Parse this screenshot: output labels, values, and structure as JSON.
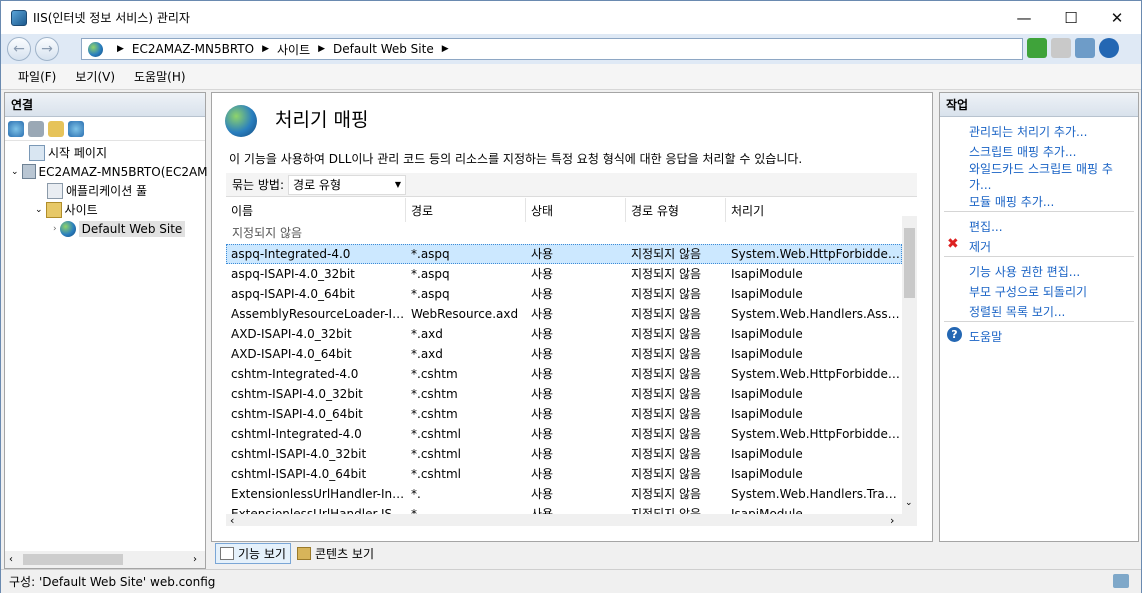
{
  "window": {
    "title": "IIS(인터넷 정보 서비스) 관리자",
    "minimize": "—",
    "maximize": "☐",
    "close": "✕"
  },
  "address": {
    "crumbs": [
      "EC2AMAZ-MN5BRTO",
      "사이트",
      "Default Web Site"
    ]
  },
  "menu": [
    "파일(F)",
    "보기(V)",
    "도움말(H)"
  ],
  "connections": {
    "title": "연결",
    "tree": [
      {
        "label": "시작 페이지",
        "icon": "start-page-icon"
      },
      {
        "label": "EC2AMAZ-MN5BRTO(EC2AM",
        "icon": "server-icon"
      },
      {
        "label": "애플리케이션 풀",
        "icon": "app-pool-icon"
      },
      {
        "label": "사이트",
        "icon": "sites-folder-icon"
      },
      {
        "label": "Default Web Site",
        "icon": "website-globe-icon"
      }
    ]
  },
  "main": {
    "title": "처리기 매핑",
    "description": "이 기능을 사용하여 DLL이나 관리 코드 등의 리소스를 지정하는 특정 요청 형식에 대한 응답을 처리할 수 있습니다.",
    "group_label": "묶는 방법:",
    "group_value": "경로 유형",
    "columns": [
      "이름",
      "경로",
      "상태",
      "경로 유형",
      "처리기"
    ],
    "group_header": "지정되지 않음",
    "rows": [
      [
        "aspq-Integrated-4.0",
        "*.aspq",
        "사용",
        "지정되지 않음",
        "System.Web.HttpForbiddenH..."
      ],
      [
        "aspq-ISAPI-4.0_32bit",
        "*.aspq",
        "사용",
        "지정되지 않음",
        "IsapiModule"
      ],
      [
        "aspq-ISAPI-4.0_64bit",
        "*.aspq",
        "사용",
        "지정되지 않음",
        "IsapiModule"
      ],
      [
        "AssemblyResourceLoader-Inte...",
        "WebResource.axd",
        "사용",
        "지정되지 않음",
        "System.Web.Handlers.Assem..."
      ],
      [
        "AXD-ISAPI-4.0_32bit",
        "*.axd",
        "사용",
        "지정되지 않음",
        "IsapiModule"
      ],
      [
        "AXD-ISAPI-4.0_64bit",
        "*.axd",
        "사용",
        "지정되지 않음",
        "IsapiModule"
      ],
      [
        "cshtm-Integrated-4.0",
        "*.cshtm",
        "사용",
        "지정되지 않음",
        "System.Web.HttpForbiddenH..."
      ],
      [
        "cshtm-ISAPI-4.0_32bit",
        "*.cshtm",
        "사용",
        "지정되지 않음",
        "IsapiModule"
      ],
      [
        "cshtm-ISAPI-4.0_64bit",
        "*.cshtm",
        "사용",
        "지정되지 않음",
        "IsapiModule"
      ],
      [
        "cshtml-Integrated-4.0",
        "*.cshtml",
        "사용",
        "지정되지 않음",
        "System.Web.HttpForbiddenH..."
      ],
      [
        "cshtml-ISAPI-4.0_32bit",
        "*.cshtml",
        "사용",
        "지정되지 않음",
        "IsapiModule"
      ],
      [
        "cshtml-ISAPI-4.0_64bit",
        "*.cshtml",
        "사용",
        "지정되지 않음",
        "IsapiModule"
      ],
      [
        "ExtensionlessUrlHandler-Integ...",
        "*.",
        "사용",
        "지정되지 않음",
        "System.Web.Handlers.Transfe..."
      ],
      [
        "ExtensionlessUrlHandler-ISAPI...",
        "*.",
        "사용",
        "지정되지 않음",
        "IsapiModule"
      ]
    ],
    "view_feature": "기능 보기",
    "view_content": "콘텐츠 보기"
  },
  "actions": {
    "title": "작업",
    "group1": [
      "관리되는 처리기 추가...",
      "스크립트 매핑 추가...",
      "와일드카드 스크립트 매핑 추",
      "가...",
      "모듈 매핑 추가..."
    ],
    "edit": "편집...",
    "remove": "제거",
    "group2": [
      "기능 사용 권한 편집...",
      "부모 구성으로 되돌리기",
      "정렬된 목록 보기..."
    ],
    "help": "도움말"
  },
  "status": {
    "text": "구성: 'Default Web Site' web.config"
  }
}
